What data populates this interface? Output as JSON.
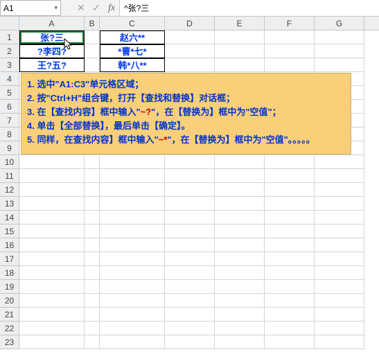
{
  "name_box": "A1",
  "formula_bar": "^张?三",
  "fx": {
    "cancel": "✕",
    "confirm": "✓",
    "label": "fx"
  },
  "columns": [
    "A",
    "B",
    "C",
    "D",
    "E",
    "F",
    "G"
  ],
  "row_headers": [
    "1",
    "2",
    "3",
    "4",
    "5",
    "6",
    "7",
    "8",
    "9",
    "10",
    "11",
    "12",
    "13",
    "14",
    "15",
    "16",
    "17",
    "18",
    "19",
    "20",
    "21",
    "22",
    "23"
  ],
  "data": {
    "A1": "张?三",
    "A2": "?李四?",
    "A3": "王?五?",
    "C1": "赵六**",
    "C2": "*曹*七*",
    "C3": "韩*八**"
  },
  "note": {
    "l1a": "1. 选中\"A1:C3\"单元格区域；",
    "l2a": "2. 按\"Ctrl+H\"组合键，打开【查找和替换】对话框；",
    "l3a": "3. 在【查找内容】框中输入\"",
    "l3b": "~?",
    "l3c": "\"，在【替换为】框中为\"空值\"；",
    "l4a": "4. 单击【全部替换】，最后单击【确定】。",
    "l5a": "5. 同样，在查找内容】框中输入\"",
    "l5b": "~*",
    "l5c": "\"，在【替换为】框中为\"空值\"。。。。。"
  }
}
